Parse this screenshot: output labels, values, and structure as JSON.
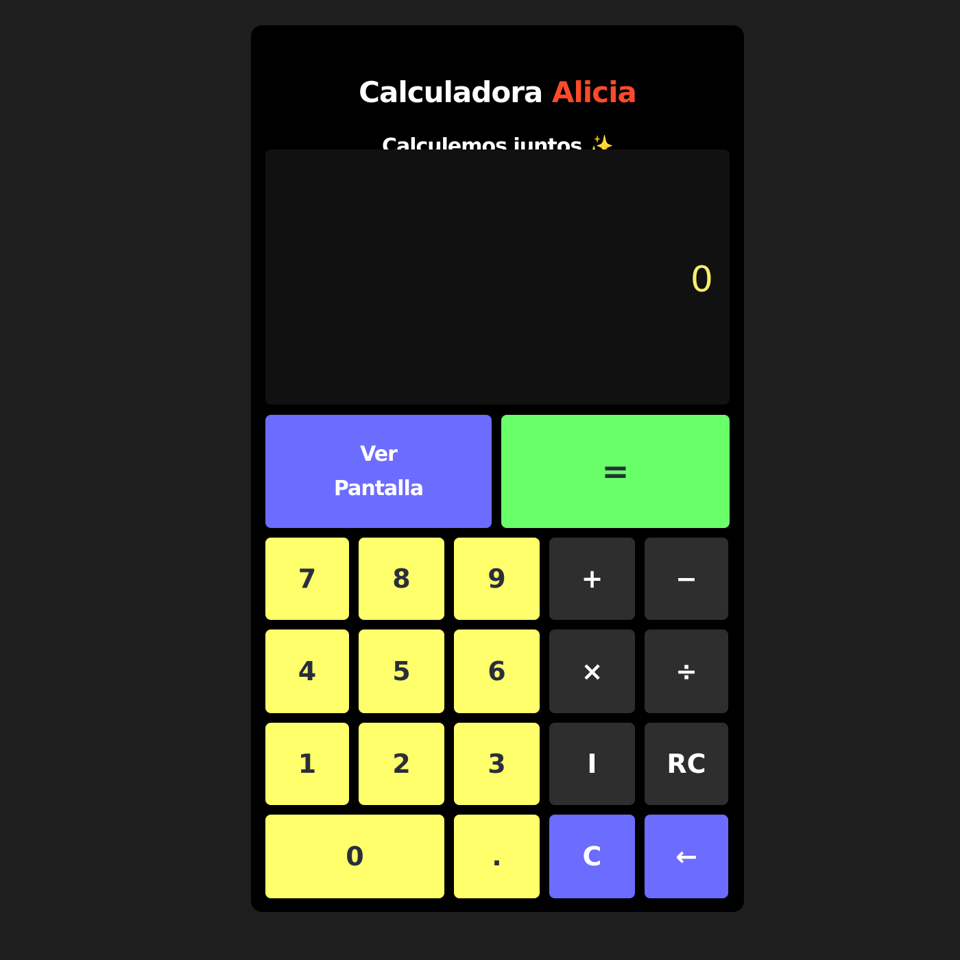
{
  "header": {
    "title_main": "Calculadora",
    "title_accent": "Alicia",
    "subtitle": "Calculemos juntos",
    "subtitle_emoji": "✨"
  },
  "display": {
    "value": "0"
  },
  "buttons": {
    "ver_pantalla_line1": "Ver",
    "ver_pantalla_line2": "Pantalla",
    "equals": "=",
    "seven": "7",
    "eight": "8",
    "nine": "9",
    "plus": "+",
    "minus": "−",
    "four": "4",
    "five": "5",
    "six": "6",
    "multiply": "×",
    "divide": "÷",
    "one": "1",
    "two": "2",
    "three": "3",
    "i": "I",
    "rc": "RC",
    "zero": "0",
    "dot": ".",
    "clear": "C",
    "backspace": "←"
  },
  "colors": {
    "accent": "#ff4a2a",
    "number_key": "#ffff6b",
    "operator_key": "#2e2e2e",
    "blue_key": "#6c6cff",
    "equals_key": "#69ff69",
    "display_text": "#f5f06a"
  }
}
